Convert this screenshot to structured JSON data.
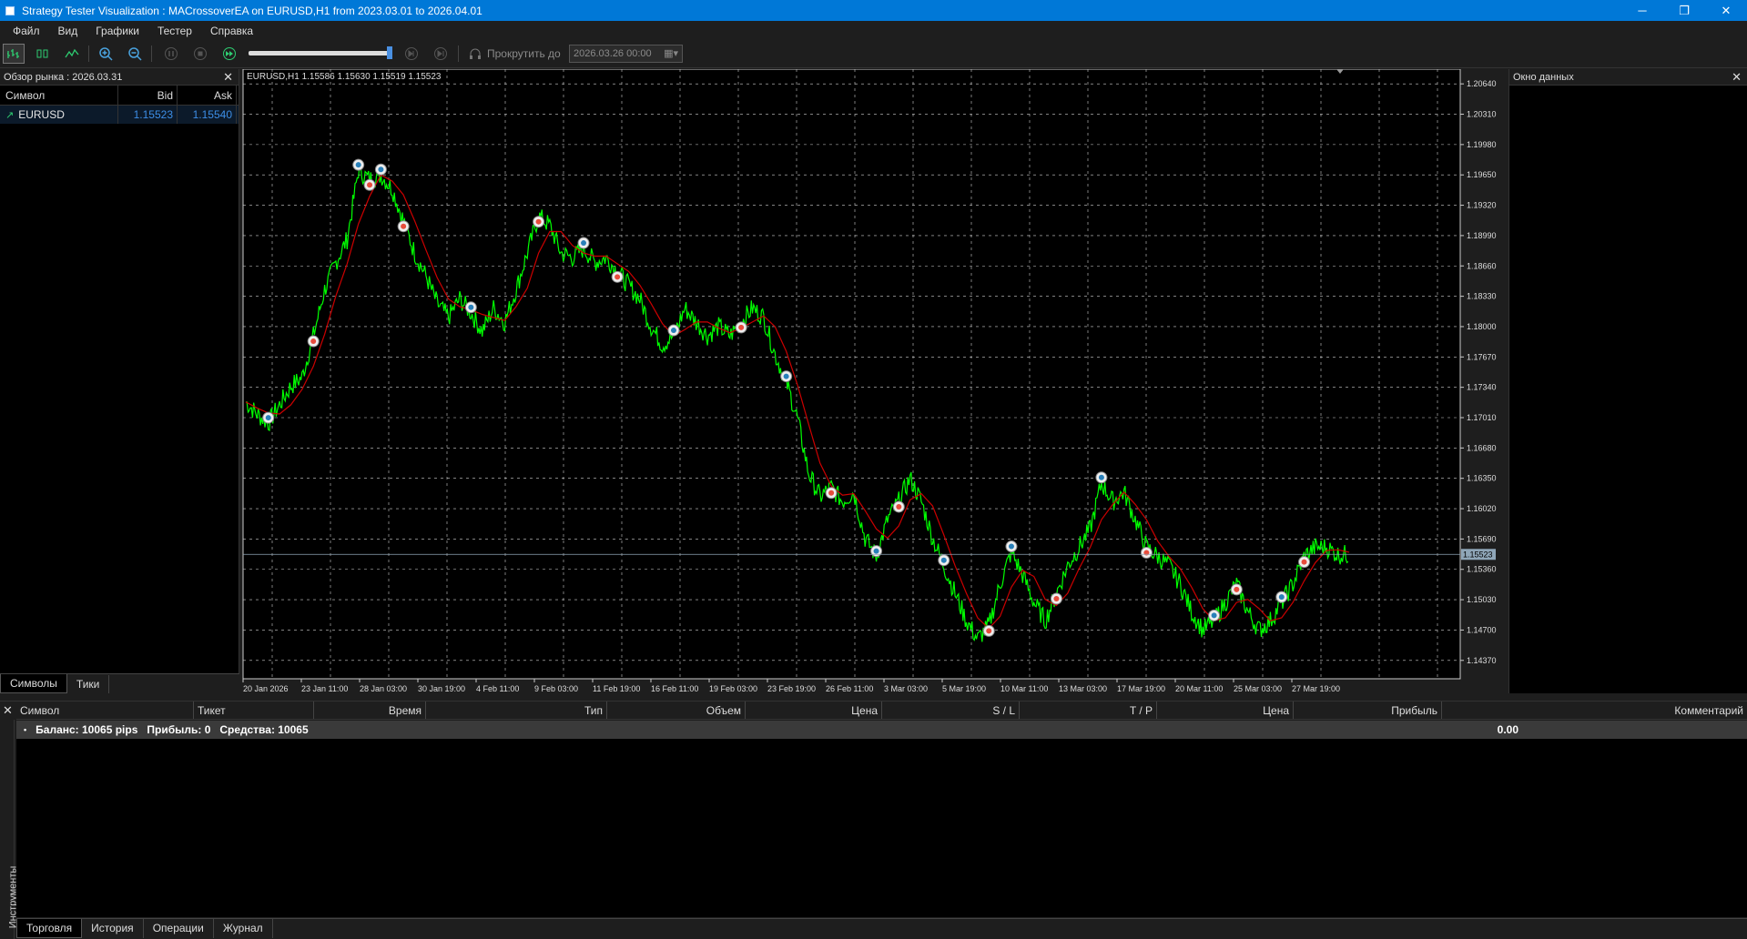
{
  "window": {
    "title": "Strategy Tester Visualization : MACrossoverEA on EURUSD,H1 from 2023.03.01 to 2026.04.01"
  },
  "menu": [
    "Файл",
    "Вид",
    "Графики",
    "Тестер",
    "Справка"
  ],
  "toolbar": {
    "scroll_label": "Прокрутить до",
    "scroll_date": "2026.03.26 00:00",
    "speed_fraction": 0.98
  },
  "market_watch": {
    "title": "Обзор рынка : 2026.03.31",
    "columns": [
      "Символ",
      "Bid",
      "Ask"
    ],
    "rows": [
      {
        "symbol": "EURUSD",
        "bid": "1.15523",
        "ask": "1.15540"
      }
    ],
    "tabs": [
      "Символы",
      "Тики"
    ]
  },
  "data_window": {
    "title": "Окно данных"
  },
  "chart": {
    "header": "EURUSD,H1  1.15586  1.15630  1.15519  1.15523",
    "current_price": "1.15523",
    "colors": {
      "bull": "#00ff00",
      "ma": "#cc0000",
      "grid": "#d0d0d0",
      "bg": "#000000"
    }
  },
  "chart_data": {
    "type": "line",
    "title": "EURUSD,H1",
    "y_ticks": [
      "1.20640",
      "1.20310",
      "1.19980",
      "1.19650",
      "1.19320",
      "1.18990",
      "1.18660",
      "1.18330",
      "1.18000",
      "1.17670",
      "1.17340",
      "1.17010",
      "1.16680",
      "1.16350",
      "1.16020",
      "1.15690",
      "1.15360",
      "1.15030",
      "1.14700",
      "1.14370"
    ],
    "x_ticks": [
      "20 Jan 2026",
      "23 Jan 11:00",
      "28 Jan 03:00",
      "30 Jan 19:00",
      "4 Feb 11:00",
      "9 Feb 03:00",
      "11 Feb 19:00",
      "16 Feb 11:00",
      "19 Feb 03:00",
      "23 Feb 19:00",
      "26 Feb 11:00",
      "3 Mar 03:00",
      "5 Mar 19:00",
      "10 Mar 11:00",
      "13 Mar 03:00",
      "17 Mar 19:00",
      "20 Mar 11:00",
      "25 Mar 03:00",
      "27 Mar 19:00"
    ],
    "ylim": [
      1.1417,
      1.208
    ],
    "series": [
      {
        "name": "",
        "x": [
          0,
          5,
          10,
          15,
          20,
          25,
          30,
          35,
          40,
          45,
          50,
          55,
          60,
          65,
          70,
          75,
          80,
          85,
          90,
          95,
          100,
          105,
          110,
          115,
          120,
          125,
          130,
          135,
          140,
          145,
          150,
          155,
          160,
          165,
          170,
          175,
          180,
          185,
          190,
          195,
          200,
          205,
          210,
          215,
          220,
          225,
          230,
          235,
          240,
          245,
          250,
          255,
          260,
          265,
          270,
          275,
          280,
          285,
          290,
          295,
          300,
          305,
          310,
          315,
          320,
          325,
          330,
          335,
          340,
          345,
          350,
          355,
          360,
          365,
          370,
          375,
          380,
          385,
          390,
          395,
          400,
          405,
          410,
          415,
          420,
          425,
          430,
          435,
          440,
          445,
          450,
          455,
          460,
          465,
          470,
          475,
          480,
          485,
          490
        ],
        "values": [
          1.1718,
          1.1705,
          1.1695,
          1.1715,
          1.1735,
          1.1745,
          1.179,
          1.184,
          1.187,
          1.1895,
          1.197,
          1.196,
          1.1965,
          1.195,
          1.1915,
          1.188,
          1.1855,
          1.1825,
          1.181,
          1.183,
          1.1815,
          1.1795,
          1.182,
          1.1805,
          1.184,
          1.188,
          1.192,
          1.191,
          1.188,
          1.1875,
          1.1885,
          1.187,
          1.1875,
          1.186,
          1.1845,
          1.183,
          1.18,
          1.178,
          1.179,
          1.182,
          1.1805,
          1.179,
          1.18,
          1.179,
          1.1805,
          1.182,
          1.181,
          1.177,
          1.174,
          1.17,
          1.164,
          1.1615,
          1.1625,
          1.161,
          1.162,
          1.157,
          1.155,
          1.159,
          1.161,
          1.1635,
          1.161,
          1.157,
          1.154,
          1.151,
          1.148,
          1.146,
          1.1475,
          1.152,
          1.1555,
          1.153,
          1.15,
          1.148,
          1.151,
          1.154,
          1.156,
          1.158,
          1.163,
          1.161,
          1.162,
          1.159,
          1.156,
          1.155,
          1.154,
          1.152,
          1.149,
          1.147,
          1.148,
          1.15,
          1.152,
          1.149,
          1.147,
          1.148,
          1.15,
          1.152,
          1.155,
          1.156,
          1.156,
          1.1552,
          1.1552
        ]
      }
    ]
  },
  "trades": {
    "columns": [
      "Символ",
      "Тикет",
      "Время",
      "Тип",
      "Объем",
      "Цена",
      "S / L",
      "T / P",
      "Цена",
      "Прибыль",
      "Комментарий"
    ],
    "balance_line": "Баланс: 10065 pips   Прибыль: 0   Средства: 10065",
    "profit": "0.00",
    "side_title": "Инструменты",
    "tabs": [
      "Торговля",
      "История",
      "Операции",
      "Журнал"
    ]
  }
}
